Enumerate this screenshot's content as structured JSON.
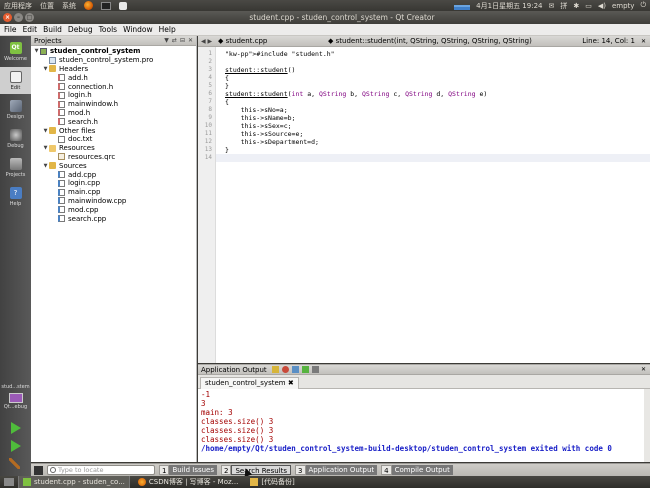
{
  "top_panel": {
    "menu": [
      "应用程序",
      "位置",
      "系统"
    ],
    "datetime": "4月1日星期五 19:24",
    "user": "empty",
    "icons": [
      "firefox-icon",
      "terminal-icon",
      "apple-icon",
      "network-graph-icon",
      "mail-icon",
      "input-method-icon",
      "bluetooth-icon",
      "battery-icon",
      "volume-icon",
      "power-icon"
    ]
  },
  "window": {
    "title": "student.cpp - studen_control_system - Qt Creator"
  },
  "menubar": [
    "File",
    "Edit",
    "Build",
    "Debug",
    "Tools",
    "Window",
    "Help"
  ],
  "modes": [
    {
      "label": "Welcome",
      "icon": "qt-logo-icon"
    },
    {
      "label": "Edit",
      "icon": "edit-icon"
    },
    {
      "label": "Design",
      "icon": "design-icon"
    },
    {
      "label": "Debug",
      "icon": "debug-icon"
    },
    {
      "label": "Projects",
      "icon": "projects-icon"
    },
    {
      "label": "Help",
      "icon": "help-icon"
    }
  ],
  "target": {
    "project": "stud...stem",
    "config": "Qt...ebug"
  },
  "projects_panel": {
    "title": "Projects",
    "tree": [
      {
        "label": "studen_control_system",
        "level": 0,
        "kind": "project",
        "expanded": true
      },
      {
        "label": "studen_control_system.pro",
        "level": 1,
        "kind": "pro"
      },
      {
        "label": "Headers",
        "level": 1,
        "kind": "folder-h",
        "expanded": true
      },
      {
        "label": "add.h",
        "level": 2,
        "kind": "h"
      },
      {
        "label": "connection.h",
        "level": 2,
        "kind": "h"
      },
      {
        "label": "login.h",
        "level": 2,
        "kind": "h"
      },
      {
        "label": "mainwindow.h",
        "level": 2,
        "kind": "h"
      },
      {
        "label": "mod.h",
        "level": 2,
        "kind": "h"
      },
      {
        "label": "search.h",
        "level": 2,
        "kind": "h"
      },
      {
        "label": "Other files",
        "level": 1,
        "kind": "folder",
        "expanded": true
      },
      {
        "label": "doc.txt",
        "level": 2,
        "kind": "file"
      },
      {
        "label": "Resources",
        "level": 1,
        "kind": "folder-r",
        "expanded": true
      },
      {
        "label": "resources.qrc",
        "level": 2,
        "kind": "qrc"
      },
      {
        "label": "Sources",
        "level": 1,
        "kind": "folder-s",
        "expanded": true
      },
      {
        "label": "add.cpp",
        "level": 2,
        "kind": "cpp"
      },
      {
        "label": "login.cpp",
        "level": 2,
        "kind": "cpp"
      },
      {
        "label": "main.cpp",
        "level": 2,
        "kind": "cpp"
      },
      {
        "label": "mainwindow.cpp",
        "level": 2,
        "kind": "cpp"
      },
      {
        "label": "mod.cpp",
        "level": 2,
        "kind": "cpp"
      },
      {
        "label": "search.cpp",
        "level": 2,
        "kind": "cpp"
      }
    ]
  },
  "editor": {
    "filename": "student.cpp",
    "function": "student::student(int, QString, QString, QString, QString)",
    "position": "Line: 14, Col: 1",
    "line_numbers": [
      "1",
      "2",
      "3",
      "4",
      "5",
      "6",
      "7",
      "8",
      "9",
      "10",
      "11",
      "12",
      "13",
      "14"
    ],
    "lines": [
      "#include \"student.h\"",
      "",
      "student::student()",
      "{",
      "}",
      "student::student(int a, QString b, QString c, QString d, QString e)",
      "{",
      "    this->sNo=a;",
      "    this->sName=b;",
      "    this->sSex=c;",
      "    this->sSource=e;",
      "    this->sDepartment=d;",
      "}",
      ""
    ]
  },
  "output": {
    "title": "Application Output",
    "tab": "studen_control_system",
    "lines": [
      "-1",
      "3",
      "main: 3",
      "classes.size() 3",
      "classes.size() 3",
      "classes.size() 3"
    ],
    "exit_line": "/home/empty/Qt/studen_control_system-build-desktop/studen_control_system exited with code 0"
  },
  "bottombar": {
    "locator_placeholder": "Type to locate",
    "tabs": [
      {
        "num": "1",
        "label": "Build Issues"
      },
      {
        "num": "2",
        "label": "Search Results"
      },
      {
        "num": "3",
        "label": "Application Output"
      },
      {
        "num": "4",
        "label": "Compile Output"
      }
    ]
  },
  "taskbar": {
    "items": [
      {
        "label": "student.cpp - studen_co...",
        "icon": "qt-icon"
      },
      {
        "label": "CSDN博客 | 写博客 - Moz...",
        "icon": "firefox-icon"
      },
      {
        "label": "[代码备份]",
        "icon": "folder-icon"
      }
    ]
  }
}
